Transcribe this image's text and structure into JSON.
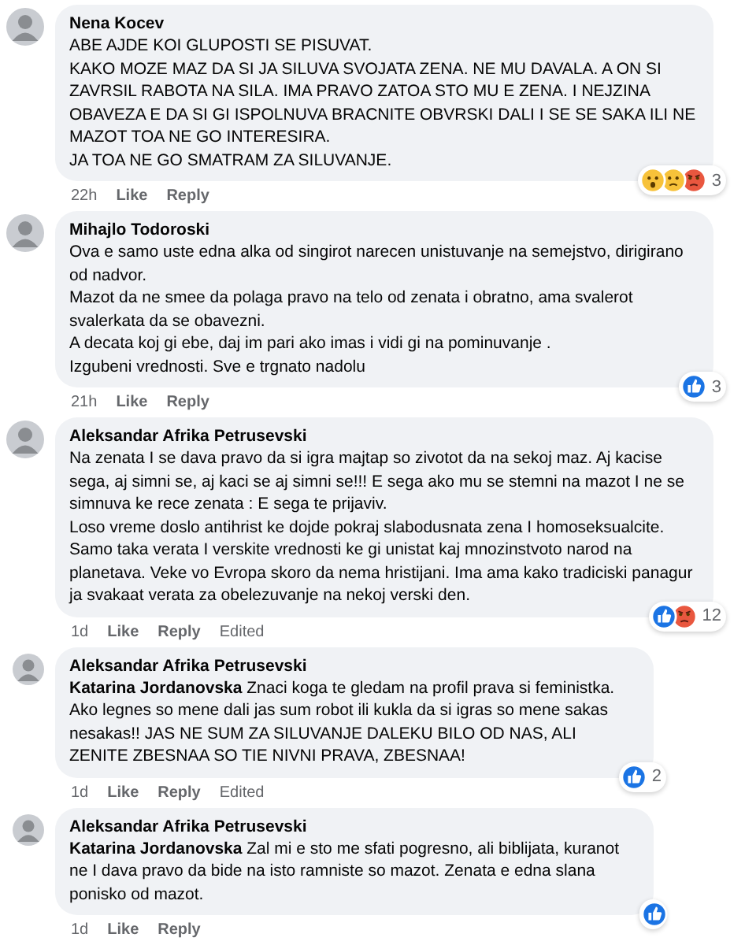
{
  "comments": [
    {
      "kind": "comment",
      "author": "Nena Kocev",
      "body": "ABE AJDE KOI GLUPOSTI SE PISUVAT.\nKAKO MOZE MAZ DA SI JA SILUVA SVOJATA ZENA. NE MU DAVALA. A ON SI ZAVRSIL RABOTA NA SILA. IMA PRAVO ZATOA STO MU E ZENA. I NEJZINA OBAVEZA E DA SI GI ISPOLNUVA BRACNITE OBVRSKI DALI I SE SE SAKA ILI NE MAZOT TOA NE GO INTERESIRA.\nJA TOA NE GO SMATRAM ZA SILUVANJE.",
      "time": "22h",
      "actions": [
        "Like",
        "Reply"
      ],
      "reactions": [
        {
          "kind": "wow"
        },
        {
          "kind": "sad"
        },
        {
          "kind": "angry"
        }
      ],
      "reaction_count": "3"
    },
    {
      "kind": "comment",
      "author": "Mihajlo Todoroski",
      "body": "Ova e samo uste edna alka od singirot narecen unistuvanje na semejstvo, dirigirano od nadvor.\nMazot da ne smee da polaga pravo na telo od zenata i obratno, ama svalerot svalerkata da se obavezni.\nA decata koj gi ebe, daj im pari ako imas i vidi gi na pominuvanje .\nIzgubeni vrednosti. Sve e trgnato nadolu",
      "time": "21h",
      "actions": [
        "Like",
        "Reply"
      ],
      "reactions": [
        {
          "kind": "like"
        }
      ],
      "reaction_count": "3"
    },
    {
      "kind": "comment",
      "author": "Aleksandar Afrika Petrusevski",
      "body": "Na zenata I se dava pravo da si igra majtap so zivotot da na sekoj maz. Aj kacise sega, aj simni se, aj kaci se aj simni se!!! E sega ako mu se stemni na mazot I ne se simnuva ke rece zenata : E sega te prijaviv.\nLoso vreme doslo antihrist ke dojde pokraj slabodusnata zena I homoseksualcite. Samo taka verata I verskite vrednosti ke gi unistat kaj mnozinstvoto narod na planetava. Veke vo Evropa skoro da nema hristijani. Ima ama kako tradiciski panagur ja svakaat verata za obelezuvanje na nekoj verski den.",
      "time": "1d",
      "actions": [
        "Like",
        "Reply"
      ],
      "edited": "Edited",
      "reactions": [
        {
          "kind": "like"
        },
        {
          "kind": "angry"
        }
      ],
      "reaction_count": "12"
    },
    {
      "kind": "reply",
      "author": "Aleksandar Afrika Petrusevski",
      "body": "**Katarina Jordanovska** Znaci koga te gledam na profil prava si feministka. Ako legnes so mene dali jas sum robot ili kukla da si igras so mene sakas nesakas!! JAS NE SUM ZA SILUVANJE DALEKU BILO OD NAS, ALI ZENITE ZBESNAA SO TIE NIVNI PRAVA, ZBESNAA!",
      "time": "1d",
      "actions": [
        "Like",
        "Reply"
      ],
      "edited": "Edited",
      "reactions": [
        {
          "kind": "like"
        }
      ],
      "reaction_count": "2"
    },
    {
      "kind": "reply",
      "author": "Aleksandar Afrika Petrusevski",
      "body": "**Katarina Jordanovska** Zal mi e sto me sfati pogresno, ali biblijata, kuranot ne I dava pravo da bide na isto ramniste so mazot. Zenata e edna slana ponisko od mazot.",
      "time": "1d",
      "actions": [
        "Like",
        "Reply"
      ],
      "reactions": [
        {
          "kind": "like"
        }
      ]
    }
  ]
}
